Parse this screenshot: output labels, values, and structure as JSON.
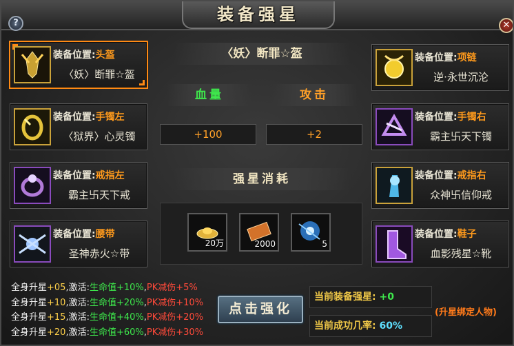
{
  "window": {
    "title": "装备强星",
    "help_icon": "help-icon",
    "close_icon": "close-icon"
  },
  "left_slots": [
    {
      "caption": "装备位置:",
      "slot": "头盔",
      "name": "〈妖〉断罪☆盔",
      "icon": "helmet-icon",
      "frame": "gold",
      "selected": true
    },
    {
      "caption": "装备位置:",
      "slot": "手镯左",
      "name": "〈狱界〉心灵镯",
      "icon": "bracelet-icon",
      "frame": "gold",
      "selected": false
    },
    {
      "caption": "装备位置:",
      "slot": "戒指左",
      "name": "霸主卐天下戒",
      "icon": "ring-icon",
      "frame": "purple",
      "selected": false
    },
    {
      "caption": "装备位置:",
      "slot": "腰带",
      "name": "圣神赤火☆带",
      "icon": "belt-icon",
      "frame": "purple",
      "selected": false
    }
  ],
  "right_slots": [
    {
      "caption": "装备位置:",
      "slot": "项链",
      "name": "逆·永世沉沦",
      "icon": "necklace-icon",
      "frame": "gold",
      "selected": false
    },
    {
      "caption": "装备位置:",
      "slot": "手镯右",
      "name": "霸主卐天下镯",
      "icon": "bracelet-icon",
      "frame": "purple",
      "selected": false
    },
    {
      "caption": "装备位置:",
      "slot": "戒指右",
      "name": "众神卐信仰戒",
      "icon": "ring-icon",
      "frame": "gold",
      "selected": false
    },
    {
      "caption": "装备位置:",
      "slot": "鞋子",
      "name": "血影残星☆靴",
      "icon": "boots-icon",
      "frame": "purple",
      "selected": false
    }
  ],
  "center": {
    "item_title": "〈妖〉断罪☆盔",
    "hp_label": "血量",
    "attack_label": "攻击",
    "hp_value": "+100",
    "attack_value": "+2",
    "cost_title": "强星消耗",
    "costs": [
      {
        "icon": "gold-ingot-icon",
        "amount": "20万"
      },
      {
        "icon": "scroll-icon",
        "amount": "2000"
      },
      {
        "icon": "star-stone-icon",
        "amount": "5"
      }
    ]
  },
  "bonus_lines": [
    {
      "prefix": "全身升星",
      "level": "+05",
      "mid": ",激活:",
      "hp": "生命值+10%",
      "sep": ",",
      "pk": "PK减伤+5%"
    },
    {
      "prefix": "全身升星",
      "level": "+10",
      "mid": ",激活:",
      "hp": "生命值+20%",
      "sep": ",",
      "pk": "PK减伤+10%"
    },
    {
      "prefix": "全身升星",
      "level": "+15",
      "mid": ",激活:",
      "hp": "生命值+40%",
      "sep": ",",
      "pk": "PK减伤+20%"
    },
    {
      "prefix": "全身升星",
      "level": "+20",
      "mid": ",激活:",
      "hp": "生命值+60%",
      "sep": ",",
      "pk": "PK减伤+30%"
    }
  ],
  "enhance_button": "点击强化",
  "current_star_label": "当前装备强星:",
  "current_star_value": "+0",
  "success_label": "当前成功几率:",
  "success_value": "60%",
  "bind_note": "(升星绑定人物)",
  "colors": {
    "accent": "#ff8a14",
    "green": "#3ee84c",
    "red": "#ff4a3a",
    "gold": "#f0c848"
  }
}
